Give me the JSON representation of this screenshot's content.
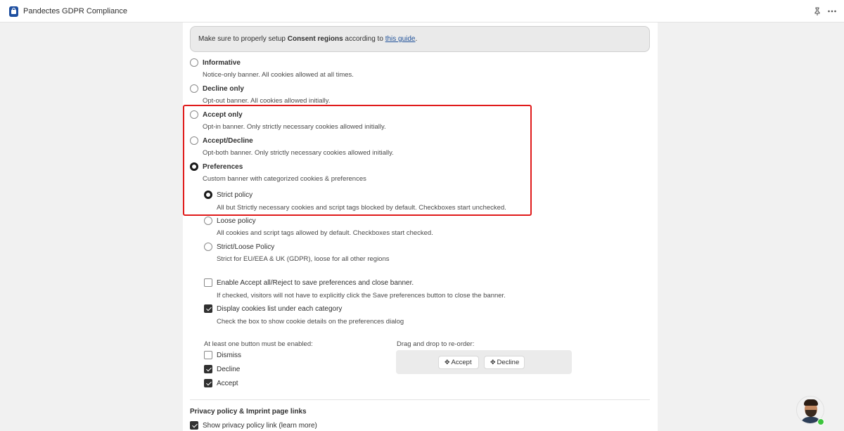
{
  "app": {
    "title": "Pandectes GDPR Compliance",
    "icon": "lock-icon"
  },
  "topbar": {
    "pin_icon": "pin-icon",
    "more_icon": "more-horizontal-icon"
  },
  "notice": {
    "prefix": "Make sure to properly setup ",
    "bold": "Consent regions",
    "middle": " according to ",
    "link": "this guide",
    "suffix": "."
  },
  "banner_types": [
    {
      "label": "Informative",
      "desc": "Notice-only banner. All cookies allowed at all times.",
      "selected": false
    },
    {
      "label": "Decline only",
      "desc": "Opt-out banner. All cookies allowed initially.",
      "selected": false
    },
    {
      "label": "Accept only",
      "desc": "Opt-in banner. Only strictly necessary cookies allowed initially.",
      "selected": false
    },
    {
      "label": "Accept/Decline",
      "desc": "Opt-both banner. Only strictly necessary cookies allowed initially.",
      "selected": false
    },
    {
      "label": "Preferences",
      "desc": "Custom banner with categorized cookies & preferences",
      "selected": true
    }
  ],
  "policies": [
    {
      "label": "Strict policy",
      "desc": "All but Strictly necessary cookies and script tags blocked by default. Checkboxes start unchecked.",
      "selected": true
    },
    {
      "label": "Loose policy",
      "desc": "All cookies and script tags allowed by default. Checkboxes start checked.",
      "selected": false
    },
    {
      "label": "Strict/Loose Policy",
      "desc": "Strict for EU/EEA & UK (GDPR), loose for all other regions",
      "selected": false
    }
  ],
  "options": [
    {
      "label": "Enable Accept all/Reject to save preferences and close banner.",
      "desc": "If checked, visitors will not have to explicitly click the Save preferences button to close the banner.",
      "checked": false
    },
    {
      "label": "Display cookies list under each category",
      "desc": "Check the box to show cookie details on the preferences dialog",
      "checked": true
    }
  ],
  "buttons_section": {
    "label": "At least one button must be enabled:",
    "items": [
      {
        "label": "Dismiss",
        "checked": false
      },
      {
        "label": "Decline",
        "checked": true
      },
      {
        "label": "Accept",
        "checked": true
      }
    ]
  },
  "reorder": {
    "label": "Drag and drop to re-order:",
    "items": [
      "Accept",
      "Decline"
    ],
    "move_icon": "move-arrows-icon"
  },
  "privacy": {
    "heading": "Privacy policy & Imprint page links",
    "show_link_label": "Show privacy policy link (learn more)",
    "show_link_checked": true
  },
  "support": {
    "avatar": "support-agent-avatar",
    "status_color": "#3cc43c"
  },
  "colors": {
    "highlight": "#e01b1b",
    "link": "#1f5199"
  }
}
